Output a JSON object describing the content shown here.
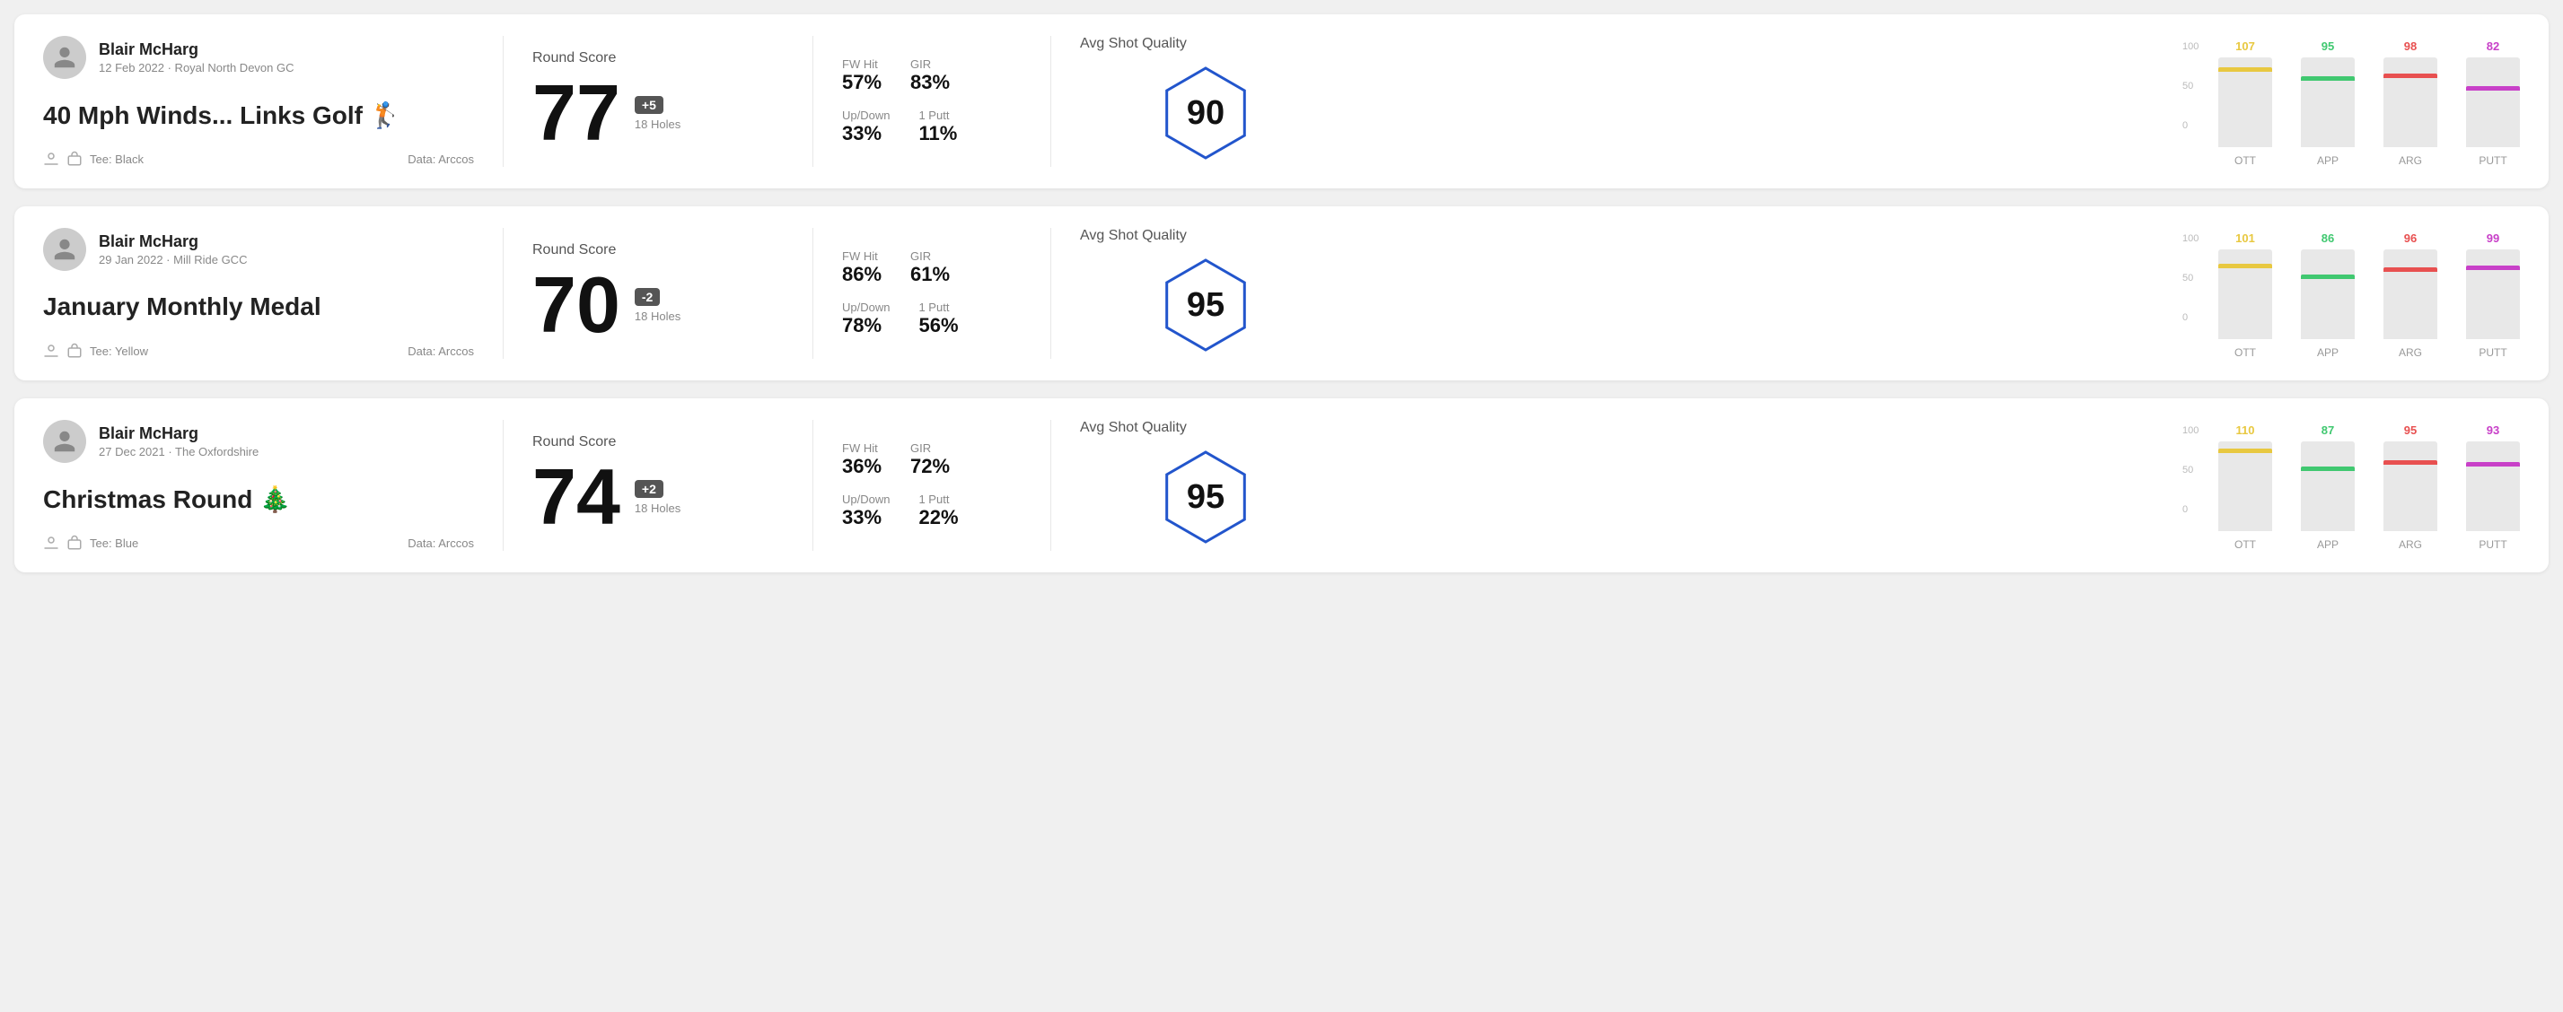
{
  "rounds": [
    {
      "id": "round-1",
      "player": "Blair McHarg",
      "date": "12 Feb 2022 · Royal North Devon GC",
      "title": "40 Mph Winds... Links Golf 🏌️",
      "tee": "Black",
      "data_source": "Data: Arccos",
      "score": "77",
      "score_diff": "+5",
      "holes": "18 Holes",
      "fw_hit": "57%",
      "gir": "83%",
      "up_down": "33%",
      "one_putt": "11%",
      "avg_quality": "90",
      "chart": {
        "ott": {
          "value": 107,
          "color": "#e8c840"
        },
        "app": {
          "value": 95,
          "color": "#40c870"
        },
        "arg": {
          "value": 98,
          "color": "#e85050"
        },
        "putt": {
          "value": 82,
          "color": "#c840c8"
        }
      }
    },
    {
      "id": "round-2",
      "player": "Blair McHarg",
      "date": "29 Jan 2022 · Mill Ride GCC",
      "title": "January Monthly Medal",
      "tee": "Yellow",
      "data_source": "Data: Arccos",
      "score": "70",
      "score_diff": "-2",
      "holes": "18 Holes",
      "fw_hit": "86%",
      "gir": "61%",
      "up_down": "78%",
      "one_putt": "56%",
      "avg_quality": "95",
      "chart": {
        "ott": {
          "value": 101,
          "color": "#e8c840"
        },
        "app": {
          "value": 86,
          "color": "#40c870"
        },
        "arg": {
          "value": 96,
          "color": "#e85050"
        },
        "putt": {
          "value": 99,
          "color": "#c840c8"
        }
      }
    },
    {
      "id": "round-3",
      "player": "Blair McHarg",
      "date": "27 Dec 2021 · The Oxfordshire",
      "title": "Christmas Round 🎄",
      "tee": "Blue",
      "data_source": "Data: Arccos",
      "score": "74",
      "score_diff": "+2",
      "holes": "18 Holes",
      "fw_hit": "36%",
      "gir": "72%",
      "up_down": "33%",
      "one_putt": "22%",
      "avg_quality": "95",
      "chart": {
        "ott": {
          "value": 110,
          "color": "#e8c840"
        },
        "app": {
          "value": 87,
          "color": "#40c870"
        },
        "arg": {
          "value": 95,
          "color": "#e85050"
        },
        "putt": {
          "value": 93,
          "color": "#c840c8"
        }
      }
    }
  ],
  "labels": {
    "round_score": "Round Score",
    "fw_hit": "FW Hit",
    "gir": "GIR",
    "up_down": "Up/Down",
    "one_putt": "1 Putt",
    "avg_quality": "Avg Shot Quality",
    "ott": "OTT",
    "app": "APP",
    "arg": "ARG",
    "putt": "PUTT",
    "tee_prefix": "Tee:",
    "y100": "100",
    "y50": "50",
    "y0": "0"
  }
}
